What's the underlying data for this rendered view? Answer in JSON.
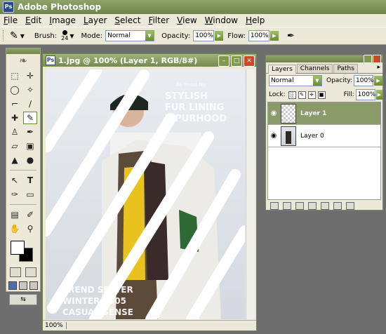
{
  "app": {
    "title": "Adobe Photoshop"
  },
  "menu": [
    "File",
    "Edit",
    "Image",
    "Layer",
    "Select",
    "Filter",
    "View",
    "Window",
    "Help"
  ],
  "options": {
    "brush_label": "Brush:",
    "brush_size": "24",
    "mode_label": "Mode:",
    "mode_value": "Normal",
    "opacity_label": "Opacity:",
    "opacity_value": "100%",
    "flow_label": "Flow:",
    "flow_value": "100%"
  },
  "document": {
    "title": "1.jpg @ 100% (Layer 1, RGB/8#)",
    "zoom": "100%",
    "image_text": {
      "magazine_top": "All Trend No",
      "headline_1": "STYLISH",
      "headline_2": "FUR LINING",
      "headline_3": "ZIPURHOOD",
      "bottom_1": "TREND SETTER",
      "bottom_2": "WINTER 2005",
      "bottom_3": "CASUAL SENSE"
    }
  },
  "layers_panel": {
    "tabs": [
      "Layers",
      "Channels",
      "Paths"
    ],
    "blend_mode": "Normal",
    "opacity_label": "Opacity:",
    "opacity_value": "100%",
    "lock_label": "Lock:",
    "fill_label": "Fill:",
    "fill_value": "100%",
    "layers": [
      {
        "name": "Layer 1",
        "selected": true
      },
      {
        "name": "Layer 0",
        "selected": false
      }
    ]
  },
  "colors": {
    "accent": "#6f8447",
    "foreground": "#ffffff",
    "background": "#000000"
  }
}
